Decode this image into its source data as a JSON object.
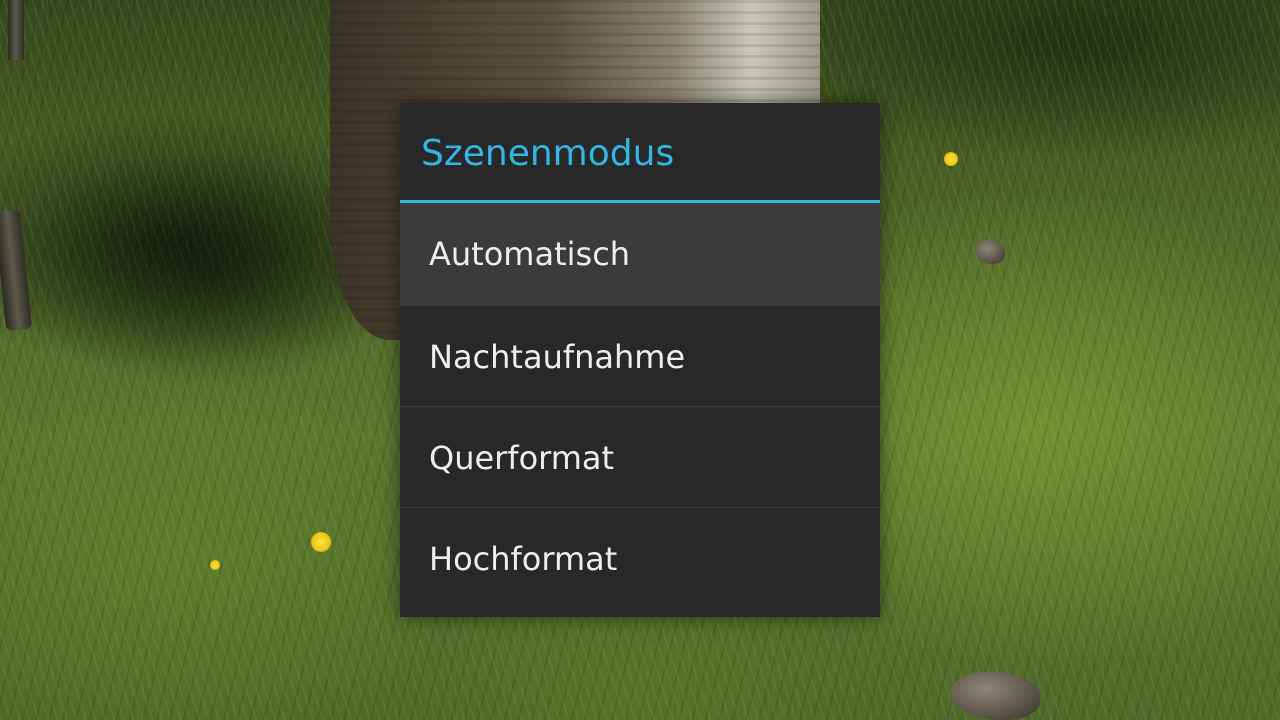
{
  "viewfinder": {
    "description_icon": "camera-preview"
  },
  "dialog": {
    "title": "Szenenmodus",
    "accent_color": "#33b5e5",
    "background_color": "#282828",
    "options": [
      {
        "label": "Automatisch",
        "selected": true
      },
      {
        "label": "Nachtaufnahme",
        "selected": false
      },
      {
        "label": "Querformat",
        "selected": false
      },
      {
        "label": "Hochformat",
        "selected": false
      }
    ]
  }
}
